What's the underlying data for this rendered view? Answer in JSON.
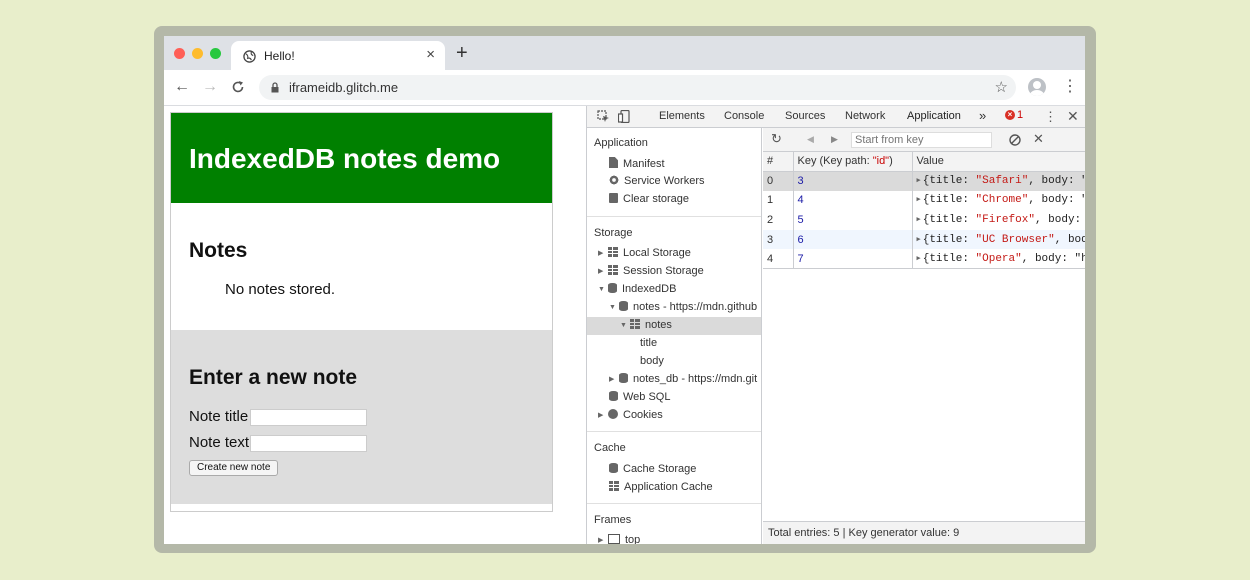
{
  "browser": {
    "tab_title": "Hello!",
    "tab_close": "×",
    "new_tab": "+",
    "url": "iframeidb.glitch.me",
    "traffic_colors": [
      "#ff5f57",
      "#febc2e",
      "#28c840"
    ]
  },
  "page": {
    "header": "IndexedDB notes demo",
    "notes_heading": "Notes",
    "empty_message": "No notes stored.",
    "form_heading": "Enter a new note",
    "title_label": "Note title",
    "text_label": "Note text",
    "create_button": "Create new note",
    "header_color": "#008000"
  },
  "devtools": {
    "tabs": [
      "Elements",
      "Console",
      "Sources",
      "Network",
      "Application"
    ],
    "active_tab": "Application",
    "more": "»",
    "error_count": "1",
    "sidebar": {
      "application_section": "Application",
      "manifest": "Manifest",
      "service_workers": "Service Workers",
      "clear_storage": "Clear storage",
      "storage_section": "Storage",
      "local_storage": "Local Storage",
      "session_storage": "Session Storage",
      "indexeddb": "IndexedDB",
      "notes_db": "notes - https://mdn.github",
      "notes_store": "notes",
      "index_title": "title",
      "index_body": "body",
      "notes_db2": "notes_db - https://mdn.git",
      "web_sql": "Web SQL",
      "cookies": "Cookies",
      "cache_section": "Cache",
      "cache_storage": "Cache Storage",
      "application_cache": "Application Cache",
      "frames_section": "Frames",
      "top_frame": "top"
    },
    "db_toolbar": {
      "start_key_placeholder": "Start from key"
    },
    "table": {
      "col_index": "#",
      "col_key_prefix": "Key (Key path: ",
      "col_key_path": "\"id\"",
      "col_key_suffix": ")",
      "col_value": "Value",
      "rows": [
        {
          "index": "0",
          "key": "3",
          "title": "\"Safari\"",
          "rest": ", body: \"ht"
        },
        {
          "index": "1",
          "key": "4",
          "title": "\"Chrome\"",
          "rest": ", body: \"ht"
        },
        {
          "index": "2",
          "key": "5",
          "title": "\"Firefox\"",
          "rest": ", body: \"h"
        },
        {
          "index": "3",
          "key": "6",
          "title": "\"UC Browser\"",
          "rest": ", body:"
        },
        {
          "index": "4",
          "key": "7",
          "title": "\"Opera\"",
          "rest": ", body: \"htt"
        }
      ],
      "value_prefix": "{title: "
    },
    "status": "Total entries: 5 | Key generator value: 9"
  }
}
